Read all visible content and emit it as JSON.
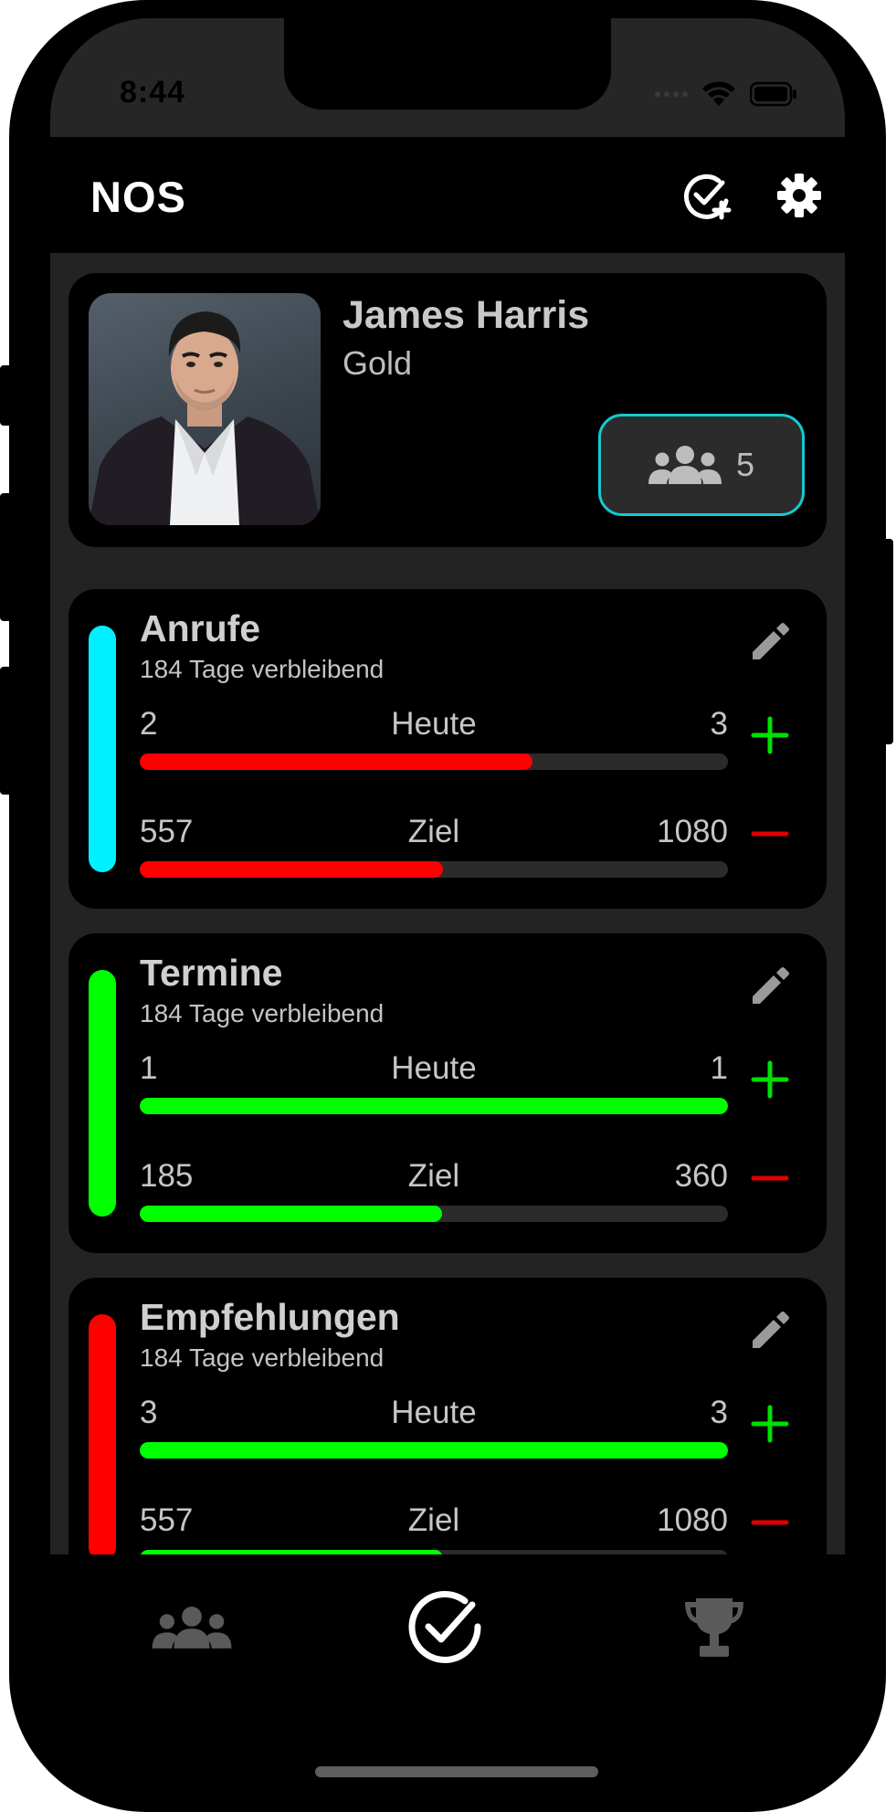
{
  "status_bar": {
    "time": "8:44"
  },
  "app_bar": {
    "title": "NOS",
    "add_goal_icon": "check-circle-plus-icon",
    "settings_icon": "gear-icon"
  },
  "profile": {
    "name": "James Harris",
    "level": "Gold",
    "team_count": "5",
    "team_accent": "#15c9d2"
  },
  "goals": [
    {
      "title": "Anrufe",
      "remaining": "184 Tage verbleibend",
      "accent": "#00f0ff",
      "today": {
        "value": "2",
        "label": "Heute",
        "target": "3",
        "progress": 0.667,
        "color": "#ff0000"
      },
      "goal": {
        "value": "557",
        "label": "Ziel",
        "target": "1080",
        "progress": 0.516,
        "color": "#ff0000"
      }
    },
    {
      "title": "Termine",
      "remaining": "184 Tage verbleibend",
      "accent": "#00ff00",
      "today": {
        "value": "1",
        "label": "Heute",
        "target": "1",
        "progress": 1.0,
        "color": "#00ff00"
      },
      "goal": {
        "value": "185",
        "label": "Ziel",
        "target": "360",
        "progress": 0.514,
        "color": "#00ff00"
      }
    },
    {
      "title": "Empfehlungen",
      "remaining": "184 Tage verbleibend",
      "accent": "#ff0000",
      "today": {
        "value": "3",
        "label": "Heute",
        "target": "3",
        "progress": 1.0,
        "color": "#00ff00"
      },
      "goal": {
        "value": "557",
        "label": "Ziel",
        "target": "1080",
        "progress": 0.516,
        "color": "#00ff00"
      }
    }
  ],
  "colors": {
    "plus": "#00e000",
    "minus": "#e00000",
    "background": "#232323",
    "card": "#000000"
  },
  "bottom_nav": {
    "items": [
      "team-icon",
      "check-circle-icon",
      "trophy-icon"
    ],
    "active": "check-circle-icon"
  }
}
